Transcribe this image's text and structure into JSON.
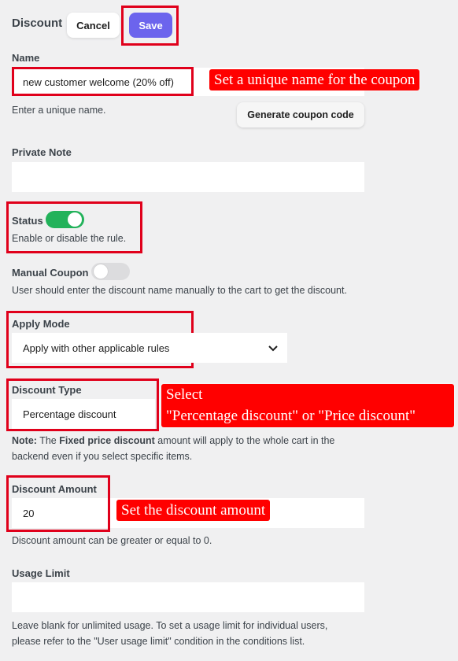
{
  "header": {
    "title": "Discount",
    "cancel_label": "Cancel",
    "save_label": "Save"
  },
  "name": {
    "label": "Name",
    "value": "new customer welcome (20% off)",
    "help": "Enter a unique name.",
    "generate_label": "Generate coupon code",
    "callout": "Set a unique name for the coupon"
  },
  "private_note": {
    "label": "Private Note",
    "value": ""
  },
  "status": {
    "label": "Status",
    "enabled": true,
    "help": "Enable or disable the rule."
  },
  "manual_coupon": {
    "label": "Manual Coupon",
    "enabled": false,
    "help": "User should enter the discount name manually to the cart to get the discount."
  },
  "apply_mode": {
    "label": "Apply Mode",
    "selected": "Apply with other applicable rules"
  },
  "discount_type": {
    "label": "Discount Type",
    "selected": "Percentage discount",
    "callout_line1": "Select",
    "callout_line2": "\"Percentage discount\" or \"Price discount\""
  },
  "note": {
    "prefix": "Note:",
    "text1": " The ",
    "emphasis": "Fixed price discount",
    "text2": " amount will apply to the whole cart in the",
    "line2": "backend even if you select specific items."
  },
  "discount_amount": {
    "label": "Discount Amount",
    "value": "20",
    "help": "Discount amount can be greater or equal to 0.",
    "callout": "Set the discount amount"
  },
  "usage_limit": {
    "label": "Usage Limit",
    "value": "",
    "help_line1": "Leave blank for unlimited usage. To set a usage limit for individual users,",
    "help_line2": "please refer to the \"User usage limit\" condition in the conditions list."
  },
  "colors": {
    "accent": "#6c64ed",
    "toggle_on": "#22b25a",
    "annotation_red": "#ff0000",
    "background": "#f0f0f1"
  }
}
